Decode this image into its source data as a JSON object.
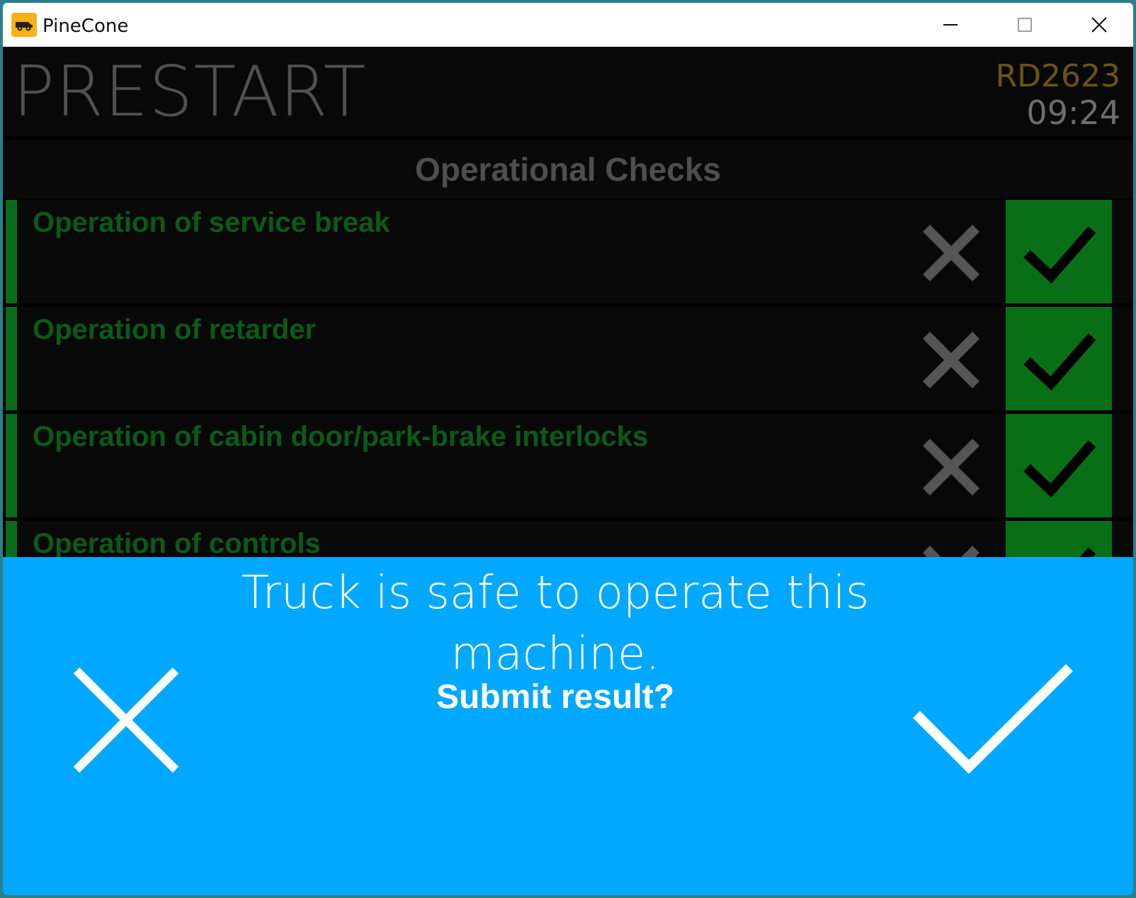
{
  "window": {
    "title": "PineCone",
    "icon": "truck-icon",
    "controls": [
      "minimize-icon",
      "maximize-icon",
      "close-icon"
    ]
  },
  "header": {
    "title": "PRESTART",
    "truck_id": "RD2623",
    "time": "09:24"
  },
  "section": {
    "title": "Operational Checks"
  },
  "checks": [
    {
      "label": "Operation of service break",
      "status": "pass"
    },
    {
      "label": "Operation of retarder",
      "status": "pass"
    },
    {
      "label": "Operation of cabin door/park-brake interlocks",
      "status": "pass"
    },
    {
      "label": "Operation of controls",
      "status": "pass"
    }
  ],
  "dialog": {
    "message": "Truck is safe to operate this machine.",
    "question": "Submit result?",
    "cancel_icon": "cross-icon",
    "confirm_icon": "check-icon"
  },
  "colors": {
    "dialog_bg": "#00a8ff",
    "pass_green": "#086f17",
    "label_green": "#0b5a17",
    "truck_id_gold": "#6a5512"
  }
}
